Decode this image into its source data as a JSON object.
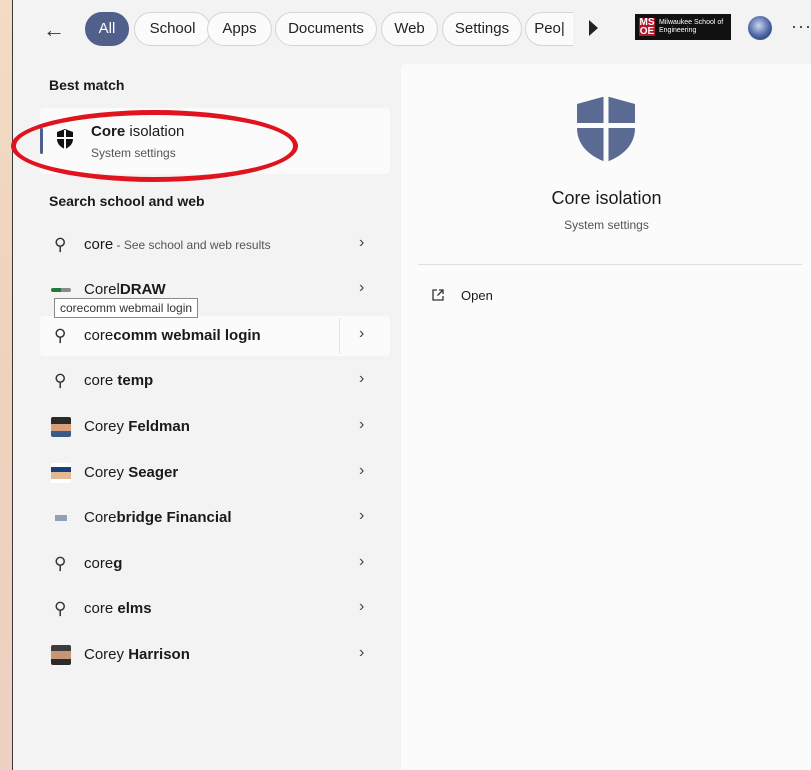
{
  "filters": {
    "back_icon": "arrow-left-icon",
    "tabs": [
      {
        "label": "All",
        "active": true
      },
      {
        "label": "School",
        "active": false
      },
      {
        "label": "Apps",
        "active": false
      },
      {
        "label": "Documents",
        "active": false
      },
      {
        "label": "Web",
        "active": false
      },
      {
        "label": "Settings",
        "active": false
      },
      {
        "label": "Peo|",
        "active": false
      }
    ],
    "org_logo": {
      "letters": "MS OE",
      "text": "Milwaukee School of Engineering"
    },
    "more_label": "···"
  },
  "best_match": {
    "section_title": "Best match",
    "name_bold": "Core",
    "name_rest": " isolation",
    "subtitle": "System settings"
  },
  "search_web": {
    "section_title": "Search school and web",
    "first": {
      "query": "core",
      "hint": " - See school and web results"
    },
    "tooltip": "corecomm webmail login",
    "items": [
      {
        "icon": "corel-logo-icon",
        "prefix": "Corel",
        "bold": "DRAW"
      },
      {
        "icon": "search-icon",
        "prefix": "core",
        "bold": "comm webmail login"
      },
      {
        "icon": "search-icon",
        "prefix": "core ",
        "bold": "temp"
      },
      {
        "icon": "person-thumbnail-icon",
        "prefix": "Corey ",
        "bold": "Feldman"
      },
      {
        "icon": "person-thumbnail-icon",
        "prefix": "Corey ",
        "bold": "Seager"
      },
      {
        "icon": "company-logo-icon",
        "prefix": "Core",
        "bold": "bridge Financial"
      },
      {
        "icon": "search-icon",
        "prefix": "core",
        "bold": "g"
      },
      {
        "icon": "search-icon",
        "prefix": "core ",
        "bold": "elms"
      },
      {
        "icon": "person-thumbnail-icon",
        "prefix": "Corey ",
        "bold": "Harrison"
      }
    ]
  },
  "preview": {
    "icon": "shield-icon",
    "title": "Core isolation",
    "subtitle": "System settings",
    "open_label": "Open"
  },
  "colors": {
    "accent": "#51608a",
    "annotation": "#e0141e"
  }
}
